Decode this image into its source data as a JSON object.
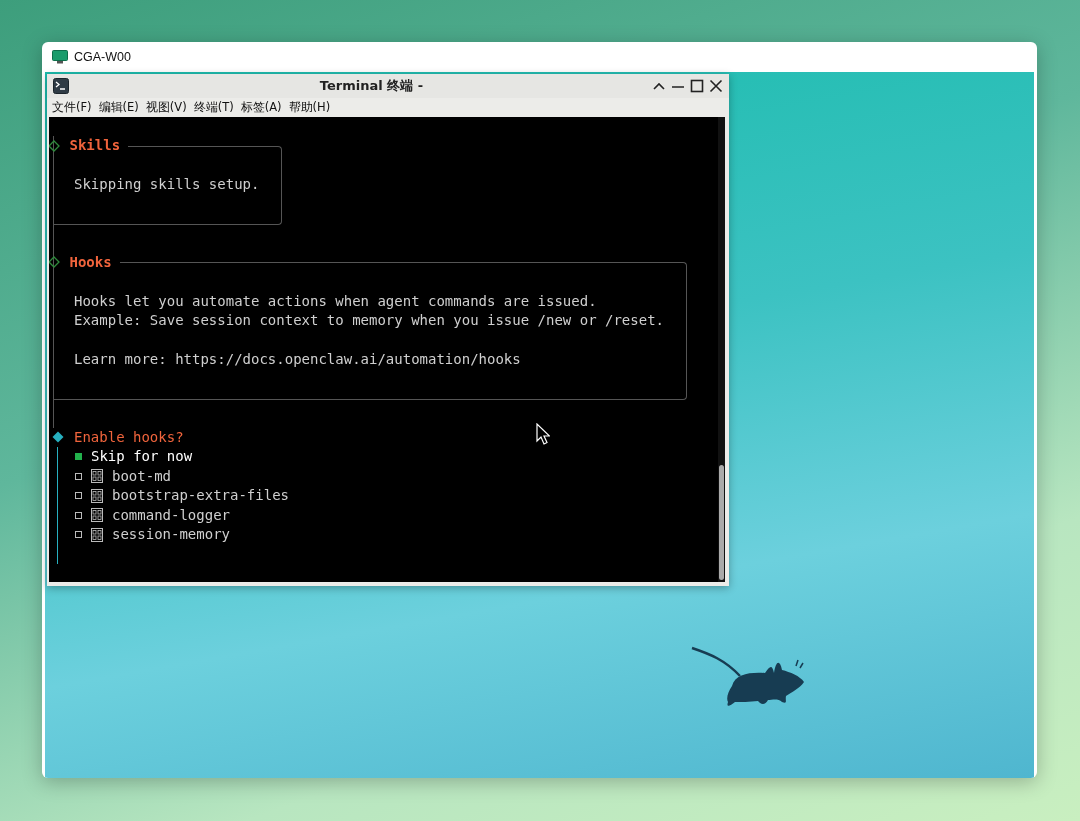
{
  "remote_window": {
    "title": "CGA-W00"
  },
  "terminal": {
    "title": "Terminal 终端 -",
    "menu": [
      "文件(F)",
      "编辑(E)",
      "视图(V)",
      "终端(T)",
      "标签(A)",
      "帮助(H)"
    ],
    "sections": [
      {
        "title": "Skills",
        "paragraphs": [
          [
            "Skipping skills setup."
          ]
        ]
      },
      {
        "title": "Hooks",
        "paragraphs": [
          [
            "Hooks let you automate actions when agent commands are issued.",
            "Example: Save session context to memory when you issue /new or /reset."
          ],
          [
            "Learn more: https://docs.openclaw.ai/automation/hooks"
          ]
        ]
      }
    ],
    "prompt": {
      "question": "Enable hooks?",
      "options": [
        {
          "kind": "plain",
          "label": "Skip for now",
          "selected": true
        },
        {
          "kind": "hook",
          "label": "boot-md",
          "selected": false
        },
        {
          "kind": "hook",
          "label": "bootstrap-extra-files",
          "selected": false
        },
        {
          "kind": "hook",
          "label": "command-logger",
          "selected": false
        },
        {
          "kind": "hook",
          "label": "session-memory",
          "selected": false
        }
      ]
    }
  }
}
